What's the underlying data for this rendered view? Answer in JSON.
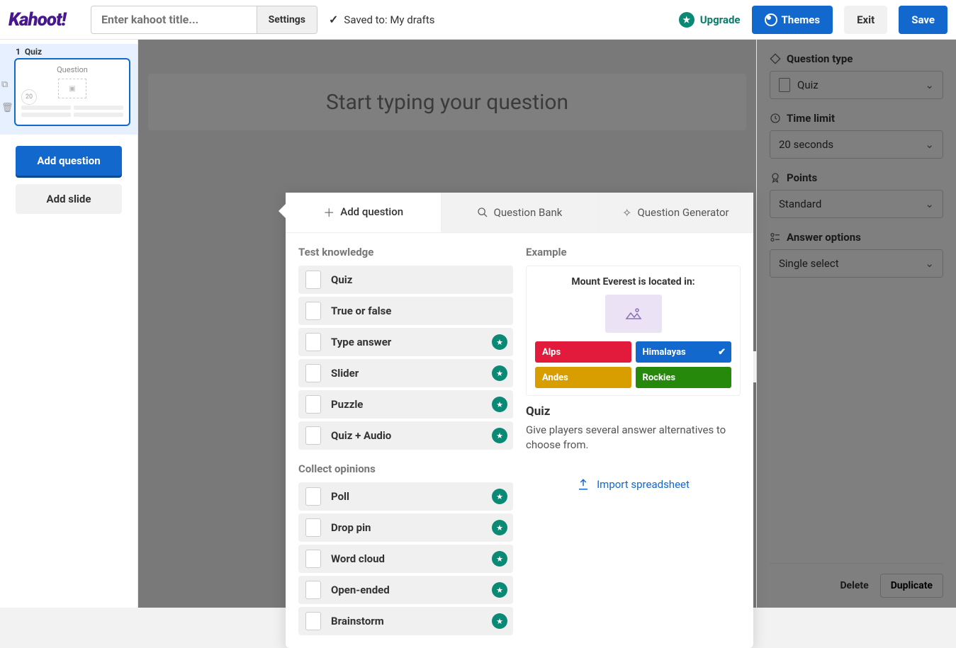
{
  "header": {
    "logo_text": "Kahoot!",
    "title_placeholder": "Enter kahoot title...",
    "settings_label": "Settings",
    "saved_label": "Saved to: My drafts",
    "upgrade_label": "Upgrade",
    "themes_label": "Themes",
    "exit_label": "Exit",
    "save_label": "Save"
  },
  "left_sidebar": {
    "slide_index": "1",
    "slide_type": "Quiz",
    "slide_title": "Question",
    "slide_timer": "20",
    "add_question_label": "Add question",
    "add_slide_label": "Add slide"
  },
  "center": {
    "question_placeholder": "Start typing your question"
  },
  "dialog": {
    "tabs": {
      "add_question": "Add question",
      "question_bank": "Question Bank",
      "question_generator": "Question Generator"
    },
    "section1_title": "Test knowledge",
    "section1_items": [
      {
        "label": "Quiz",
        "premium": false
      },
      {
        "label": "True or false",
        "premium": false
      },
      {
        "label": "Type answer",
        "premium": true
      },
      {
        "label": "Slider",
        "premium": true
      },
      {
        "label": "Puzzle",
        "premium": true
      },
      {
        "label": "Quiz + Audio",
        "premium": true
      }
    ],
    "section2_title": "Collect opinions",
    "section2_items": [
      {
        "label": "Poll",
        "premium": true
      },
      {
        "label": "Drop pin",
        "premium": true
      },
      {
        "label": "Word cloud",
        "premium": true
      },
      {
        "label": "Open-ended",
        "premium": true
      },
      {
        "label": "Brainstorm",
        "premium": true
      }
    ],
    "example_title": "Example",
    "example_question": "Mount Everest is located in:",
    "example_answers": [
      {
        "label": "Alps",
        "color": "red",
        "correct": false
      },
      {
        "label": "Himalayas",
        "color": "blue",
        "correct": true
      },
      {
        "label": "Andes",
        "color": "yellow",
        "correct": false
      },
      {
        "label": "Rockies",
        "color": "green",
        "correct": false
      }
    ],
    "example_type": "Quiz",
    "example_desc": "Give players several answer alternatives to choose from.",
    "import_label": "Import spreadsheet"
  },
  "right_sidebar": {
    "question_type_label": "Question type",
    "question_type_value": "Quiz",
    "time_limit_label": "Time limit",
    "time_limit_value": "20 seconds",
    "points_label": "Points",
    "points_value": "Standard",
    "answer_options_label": "Answer options",
    "answer_options_value": "Single select",
    "delete_label": "Delete",
    "duplicate_label": "Duplicate"
  }
}
